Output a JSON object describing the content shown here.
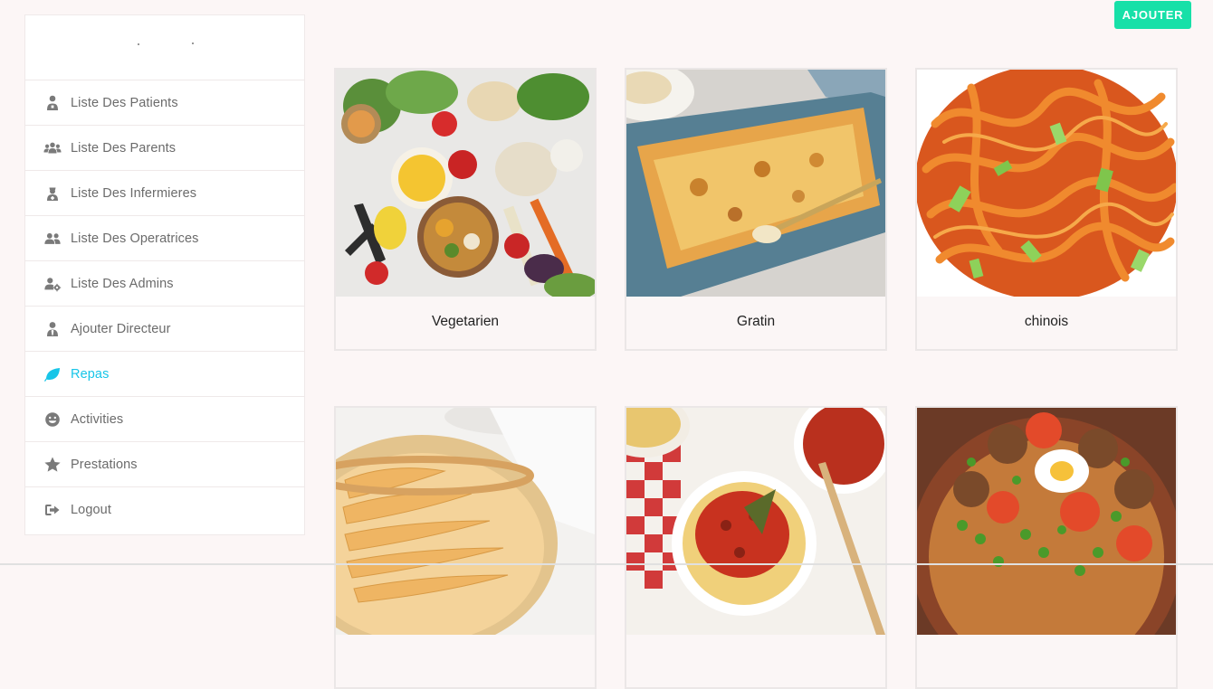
{
  "sidebar": {
    "items": [
      {
        "label": "Liste Des Patients",
        "icon": "patient-icon"
      },
      {
        "label": "Liste Des Parents",
        "icon": "users-icon"
      },
      {
        "label": "Liste Des Infermieres",
        "icon": "nurse-icon"
      },
      {
        "label": "Liste Des Operatrices",
        "icon": "user-friends-icon"
      },
      {
        "label": "Liste Des Admins",
        "icon": "user-cog-icon"
      },
      {
        "label": "Ajouter Directeur",
        "icon": "user-tie-icon"
      },
      {
        "label": "Repas",
        "icon": "leaf-icon",
        "active": true
      },
      {
        "label": "Activities",
        "icon": "smile-icon"
      },
      {
        "label": "Prestations",
        "icon": "star-icon"
      },
      {
        "label": "Logout",
        "icon": "sign-out-icon"
      }
    ]
  },
  "header": {
    "add_label": "AJOUTER"
  },
  "meals": [
    {
      "title": "Vegetarien"
    },
    {
      "title": "Gratin"
    },
    {
      "title": "chinois"
    },
    {
      "title": ""
    },
    {
      "title": ""
    },
    {
      "title": ""
    }
  ],
  "colors": {
    "accent": "#17c5e8",
    "button": "#17e0a8",
    "background": "#fcf6f6"
  }
}
